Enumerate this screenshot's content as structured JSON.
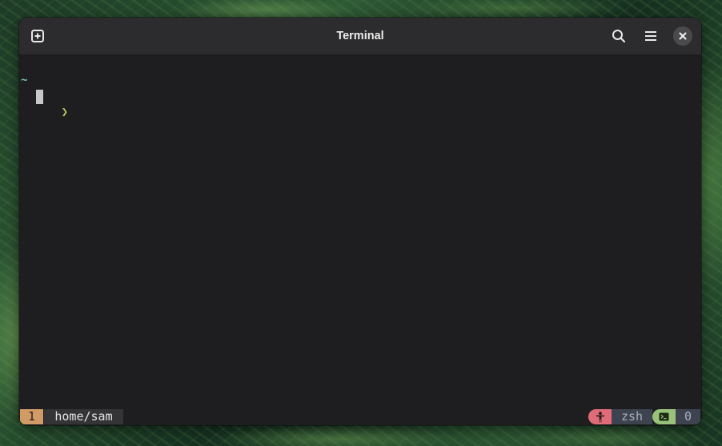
{
  "window": {
    "title": "Terminal"
  },
  "headerbar": {
    "new_tab_icon": "new-tab-icon",
    "search_icon": "search-icon",
    "menu_icon": "hamburger-menu-icon",
    "close_icon": "close-icon"
  },
  "terminal": {
    "directory": "~",
    "prompt_symbol": "❯",
    "command": ""
  },
  "statusbar": {
    "window_number": "1",
    "path": "home/sam",
    "user_icon": "person-icon",
    "shell": "zsh",
    "terminal_icon": "terminal-icon",
    "job_count": "0"
  },
  "colors": {
    "headerbar_bg": "#2c2c2e",
    "terminal_bg": "#1e1e20",
    "directory_fg": "#79c1bd",
    "prompt_fg": "#c2c45f",
    "window_number_bg": "#d19a66",
    "user_segment_bg": "#e06c78",
    "terminal_segment_bg": "#98c379",
    "info_segment_bg": "#3e4350"
  }
}
